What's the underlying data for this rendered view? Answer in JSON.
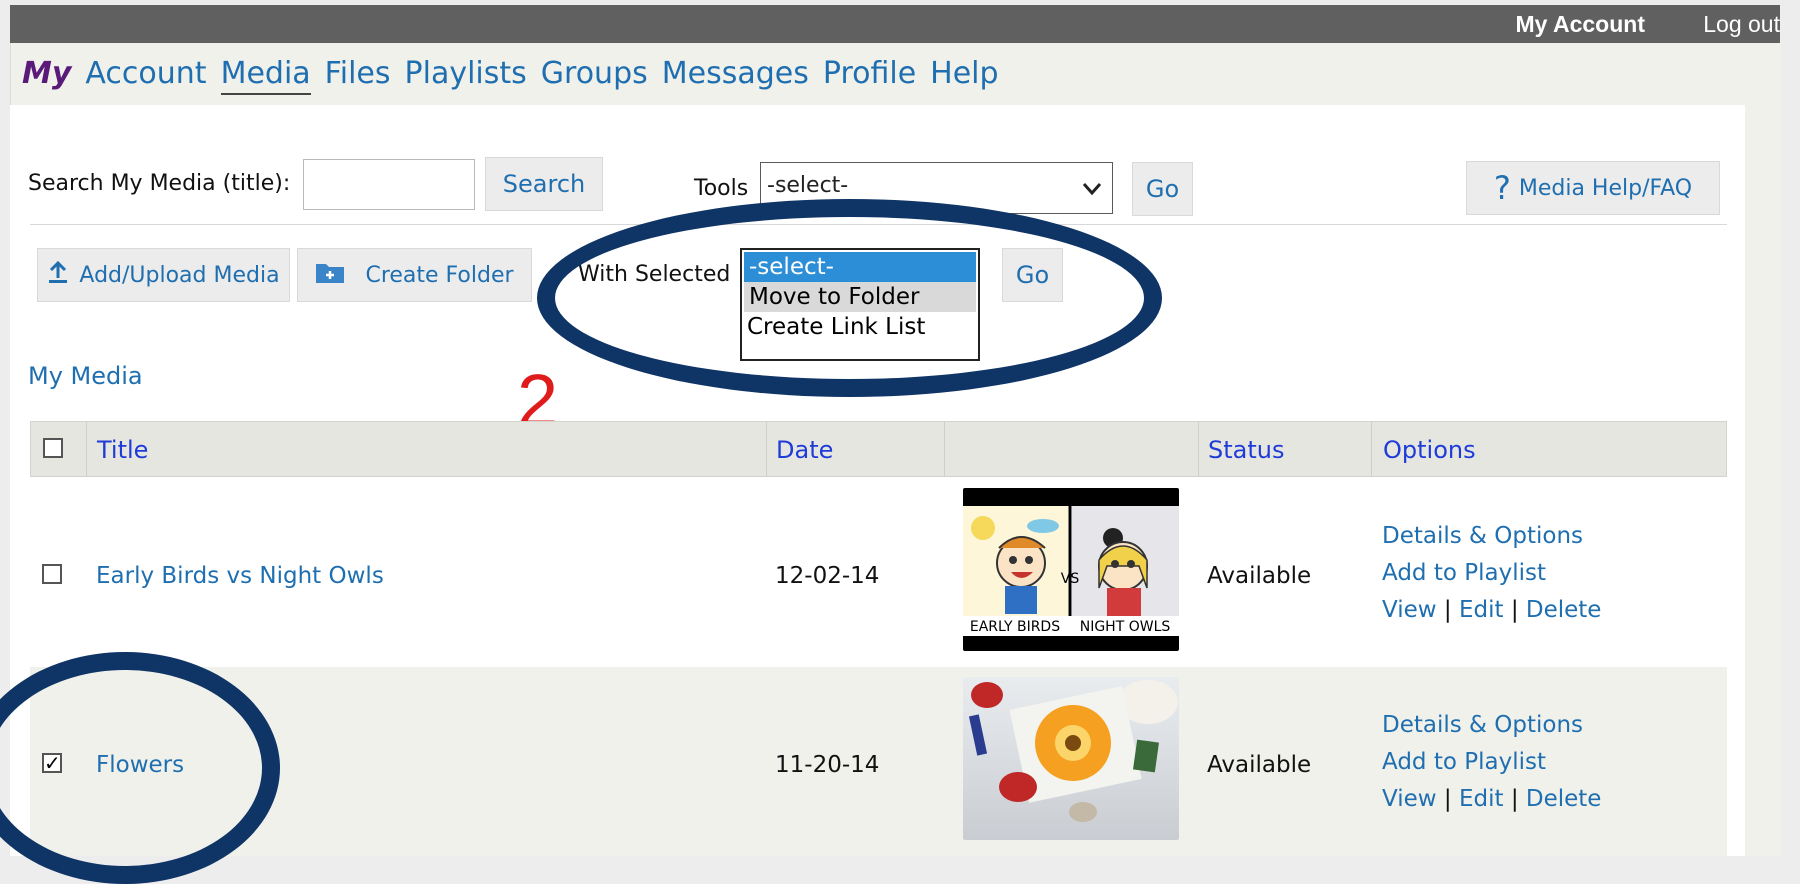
{
  "topbar": {
    "account": "My Account",
    "logout": "Log out"
  },
  "nav": {
    "my": "My",
    "items": [
      "Account",
      "Media",
      "Files",
      "Playlists",
      "Groups",
      "Messages",
      "Profile",
      "Help"
    ],
    "active": "Media"
  },
  "search": {
    "label": "Search My Media (title):",
    "value": "",
    "button": "Search"
  },
  "tools": {
    "label": "Tools",
    "selected": "-select-",
    "go": "Go"
  },
  "help": {
    "icon": "?",
    "label": "Media Help/FAQ"
  },
  "actions": {
    "upload": "Add/Upload Media",
    "create_folder": "Create Folder"
  },
  "with_selected": {
    "label": "With Selected",
    "options": [
      "-select-",
      "Move to Folder",
      "Create Link List"
    ],
    "go": "Go"
  },
  "section_title": "My Media",
  "annotation_number": "2",
  "table": {
    "headers": {
      "title": "Title",
      "date": "Date",
      "status": "Status",
      "options": "Options"
    },
    "rows": [
      {
        "checked": false,
        "title": "Early Birds vs Night Owls",
        "date": "12-02-14",
        "status": "Available",
        "thumb_caption_left": "EARLY BIRDS",
        "thumb_caption_right": "NIGHT OWLS",
        "thumb_vs": "VS",
        "details": "Details & Options",
        "playlist": "Add to Playlist",
        "view": "View",
        "edit": "Edit",
        "delete": "Delete"
      },
      {
        "checked": true,
        "title": "Flowers",
        "date": "11-20-14",
        "status": "Available",
        "details": "Details & Options",
        "playlist": "Add to Playlist",
        "view": "View",
        "edit": "Edit",
        "delete": "Delete"
      }
    ]
  },
  "colors": {
    "accent_link": "#1f6fb0",
    "header_link": "#1f3bd8",
    "annotation": "#0f3466",
    "marker": "#e01b1b"
  }
}
